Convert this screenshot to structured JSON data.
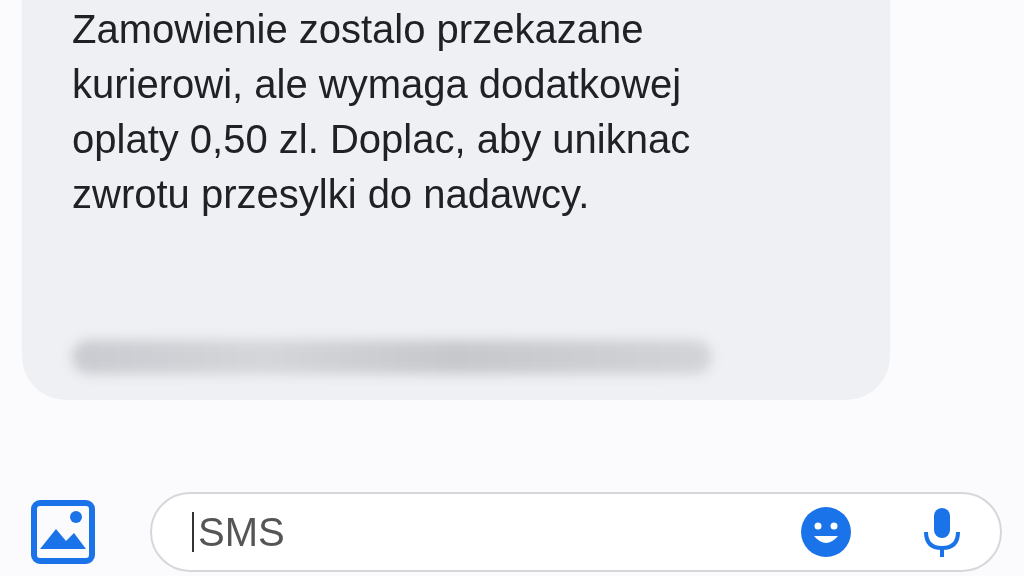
{
  "message": {
    "lines": [
      "Zamowienie zostalo przekazane",
      "kurierowi, ale wymaga dodatkowej",
      "oplaty 0,50 zl. Doplac, aby uniknac",
      "zwrotu przesylki do nadawcy."
    ],
    "link_blurred": true
  },
  "compose": {
    "placeholder": "SMS"
  }
}
